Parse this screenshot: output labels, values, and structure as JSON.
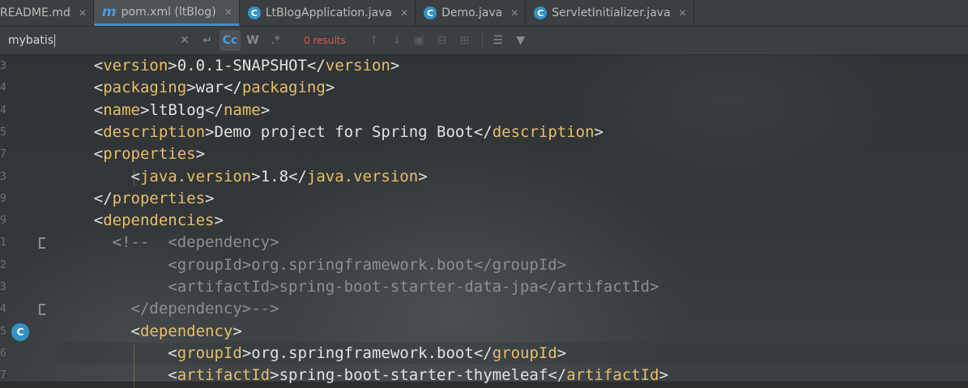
{
  "tabs": [
    {
      "label": "README.md",
      "icon": "markdown-icon",
      "active": false
    },
    {
      "label": "pom.xml (ltBlog)",
      "icon": "maven-icon",
      "active": true
    },
    {
      "label": "LtBlogApplication.java",
      "icon": "spring-class-icon",
      "active": false
    },
    {
      "label": "Demo.java",
      "icon": "class-icon",
      "active": false
    },
    {
      "label": "ServletInitializer.java",
      "icon": "class-icon",
      "active": false
    }
  ],
  "search": {
    "query": "mybatis",
    "results": "0 results"
  },
  "gutter": {
    "line_numbers": [
      "3",
      "4",
      "4",
      "5",
      "7",
      "3",
      "9",
      "9",
      "1",
      "2",
      "3",
      "4",
      "5",
      "6",
      "7"
    ]
  },
  "code_lines": [
    {
      "indent": "  ",
      "open": "version",
      "text": "0.0.1-SNAPSHOT",
      "close": "version"
    },
    {
      "indent": "  ",
      "open": "packaging",
      "text": "war",
      "close": "packaging"
    },
    {
      "indent": "  ",
      "open": "name",
      "text": "ltBlog",
      "close": "name"
    },
    {
      "indent": "  ",
      "open": "description",
      "text": "Demo project for Spring Boot",
      "close": "description"
    },
    {
      "indent": "  ",
      "open": "properties",
      "text": "",
      "close": ""
    },
    {
      "indent": "      ",
      "open": "java.version",
      "text": "1.8",
      "close": "java.version"
    },
    {
      "indent": "  ",
      "open": "",
      "text": "",
      "close": "properties"
    },
    {
      "indent": "  ",
      "open": "dependencies",
      "text": "",
      "close": ""
    },
    {
      "indent": "    ",
      "comment": "<!--  <dependency>"
    },
    {
      "indent": "          ",
      "comment": "<groupId>org.springframework.boot</groupId>"
    },
    {
      "indent": "          ",
      "comment": "<artifactId>spring-boot-starter-data-jpa</artifactId>"
    },
    {
      "indent": "      ",
      "comment": "</dependency>-->"
    },
    {
      "indent": "      ",
      "open": "dependency",
      "text": "",
      "close": ""
    },
    {
      "indent": "          ",
      "open": "groupId",
      "text": "org.springframework.boot",
      "close": "groupId"
    },
    {
      "indent": "          ",
      "open": "artifactId",
      "text": "spring-boot-starter-thymeleaf",
      "close": "artifactId"
    }
  ]
}
